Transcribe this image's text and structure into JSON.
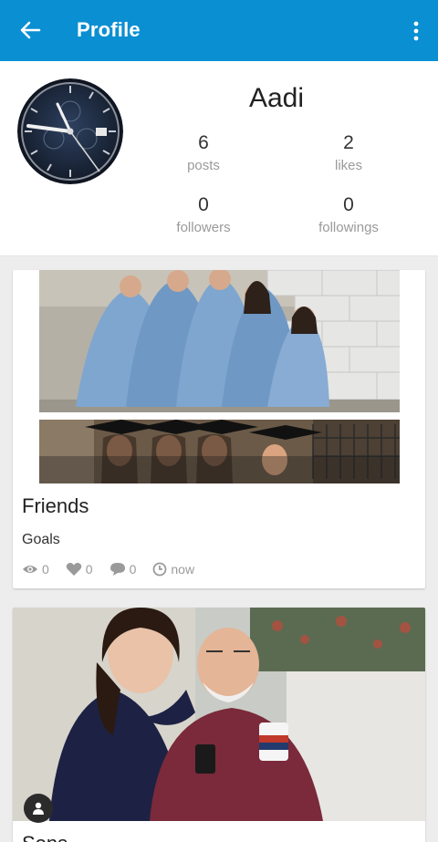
{
  "appbar": {
    "title": "Profile",
    "back_icon": "arrow-left-icon",
    "menu_icon": "more-vert-icon",
    "color": "#0a8fd2"
  },
  "profile": {
    "name": "Aadi",
    "stats": [
      {
        "value": "6",
        "label": "posts"
      },
      {
        "value": "2",
        "label": "likes"
      },
      {
        "value": "0",
        "label": "followers"
      },
      {
        "value": "0",
        "label": "followings"
      }
    ]
  },
  "posts": [
    {
      "title": "Friends",
      "subtitle": "Goals",
      "views": "0",
      "likes": "0",
      "comments": "0",
      "time": "now"
    },
    {
      "title": "Sons"
    }
  ]
}
